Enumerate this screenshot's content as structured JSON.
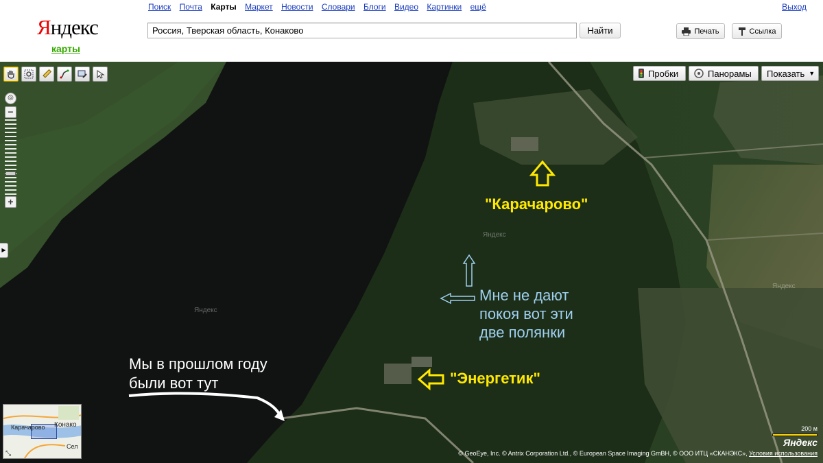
{
  "header": {
    "logo_first": "Я",
    "logo_rest": "ндекс",
    "logo_sub": "карты",
    "nav": [
      "Поиск",
      "Почта",
      "Карты",
      "Маркет",
      "Новости",
      "Словари",
      "Блоги",
      "Видео",
      "Картинки",
      "ещё"
    ],
    "nav_current": "Карты",
    "exit": "Выход",
    "search_value": "Россия, Тверская область, Конаково",
    "find_label": "Найти",
    "print_label": "Печать",
    "link_label": "Ссылка"
  },
  "map": {
    "tools": [
      "hand-icon",
      "magnifier-icon",
      "ruler-icon",
      "route-icon",
      "edit-icon",
      "select-icon"
    ],
    "buttons": {
      "traffic": "Пробки",
      "panoramas": "Панорамы",
      "show": "Показать"
    },
    "annotations": {
      "karacharovo": "\"Карачарово\"",
      "energetik": "\"Энергетик\"",
      "clearings_line1": "Мне не дают",
      "clearings_line2": "покоя вот эти",
      "clearings_line3": "две полянки",
      "last_year_line1": "Мы  в прошлом году",
      "last_year_line2": "были вот тут"
    },
    "watermarks": [
      "Яндекс",
      "Яндекс",
      "Яндекс"
    ],
    "minimap": {
      "labels": [
        "Карачарово",
        "Конако",
        "Сел"
      ]
    },
    "scale_label": "200 м",
    "brand": "Яндекс",
    "copyright": "© GeoEye, Inc. © Antrix Corporation Ltd., © European Space Imaging GmBH, © ООО ИТЦ «СКАНЭКС»,",
    "terms_link": "Условия использования"
  },
  "colors": {
    "logo_red": "#ee0000",
    "link_blue": "#1a3dc1",
    "sub_green": "#36a900",
    "annotation_yellow": "#ffe900",
    "annotation_blue": "#9fd0f0"
  }
}
